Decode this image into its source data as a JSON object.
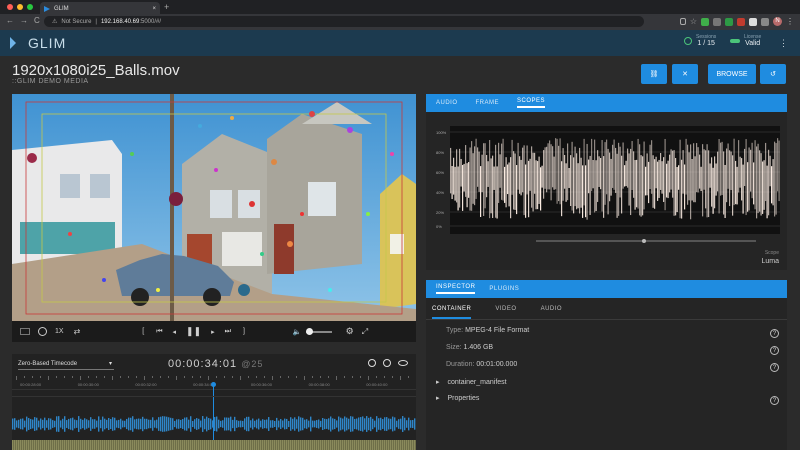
{
  "browser": {
    "tab_title": "GLIM",
    "tab_close": "×",
    "new_tab": "+",
    "nav_back": "←",
    "nav_forward": "→",
    "nav_reload": "C",
    "security": "Not Secure",
    "separator": "|",
    "host": "192.168.40.69",
    "path": ":5000/#/",
    "profile_initial": "N",
    "menu": "⋮"
  },
  "app": {
    "logo": "GLIM",
    "sessions_label": "Sessions",
    "sessions_value": "1 / 15",
    "license_label": "License",
    "license_value": "Valid",
    "menu": "⋮"
  },
  "file": {
    "title": "1920x1080i25_Balls.mov",
    "subtitle": "::GLIM DEMO MEDIA"
  },
  "actions": {
    "link": "⛓",
    "close": "✕",
    "browse": "BROWSE",
    "history": "↺"
  },
  "player": {
    "speed": "1X",
    "gear": "⚙",
    "fullscreen": "⤢",
    "volume": "🔈"
  },
  "timeline": {
    "timecode_mode": "Zero-Based Timecode",
    "dropdown_arrow": "▾",
    "timecode": "00:00:34:01",
    "rate": "@25",
    "ticks": [
      "00:00:28:00",
      "00:00:30:00",
      "00:00:32:00",
      "00:00:34:00",
      "00:00:36:00",
      "00:00:38:00",
      "00:00:40:00"
    ]
  },
  "right_panel": {
    "tabs": [
      "AUDIO",
      "FRAME",
      "SCOPES"
    ],
    "active_tab": "SCOPES",
    "scope_ticks": [
      "100%",
      "80%",
      "60%",
      "40%",
      "20%",
      "0%"
    ],
    "scope_label": "Scope",
    "scope_value": "Luma"
  },
  "inspector": {
    "tabs": [
      "INSPECTOR",
      "PLUGINS"
    ],
    "subtabs": [
      "CONTAINER",
      "VIDEO",
      "AUDIO"
    ],
    "type_key": "Type:",
    "type_val": "MPEG-4 File Format",
    "size_key": "Size:",
    "size_val": "1.406 GB",
    "duration_key": "Duration:",
    "duration_val": "00:01:00.000",
    "section1": "container_manifest",
    "section2": "Properties",
    "help": "?",
    "expand": "▸"
  },
  "colors": {
    "accent": "#1f8ce0",
    "appbar": "#1c3a4f",
    "ok": "#4bc47a"
  }
}
